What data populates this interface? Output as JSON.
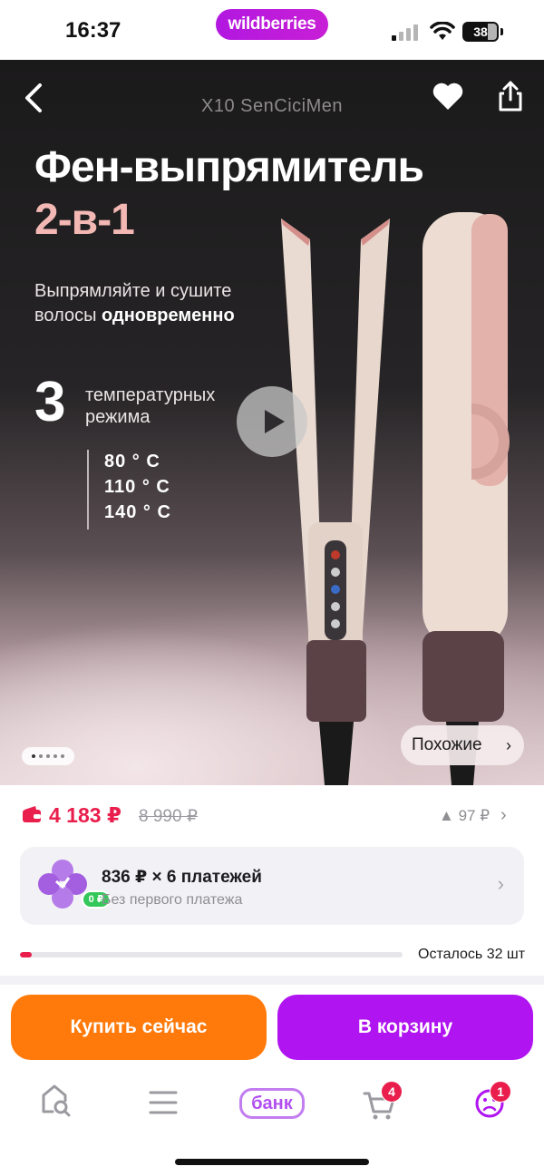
{
  "status_bar": {
    "time": "16:37",
    "brand_pill": "wildberries",
    "battery": "38",
    "icons": [
      "signal-icon",
      "wifi-icon",
      "battery-icon"
    ]
  },
  "hero": {
    "brand": "X10 SenCiciMen",
    "title_line1": "Фен-выпрямитель",
    "title_line2": "2-в-1",
    "subtitle_plain": "Выпрямляйте и сушите",
    "subtitle_line2_plain": "волосы ",
    "subtitle_bold": "одновременно",
    "modes_count": "3",
    "modes_line1": "температурных",
    "modes_line2": "режима",
    "temps": [
      "80 ° C",
      "110 ° C",
      "140 ° C"
    ],
    "similar_label": "Похожие",
    "slide_index": 1,
    "slide_count": 5,
    "colors": {
      "title_accent": "#f3b8b3"
    }
  },
  "price": {
    "current": "4 183 ₽",
    "old": "8 990 ₽",
    "delta": "97 ₽",
    "colors": {
      "current": "#e91e4c"
    }
  },
  "installment": {
    "title": "836 ₽ × 6 платежей",
    "subtitle": "Без первого платежа",
    "badge": "0 ₽"
  },
  "stock": {
    "label": "Осталось 32 шт",
    "level": 0.03
  },
  "actions": {
    "buy_now": "Купить сейчас",
    "add_to_cart": "В корзину",
    "colors": {
      "buy_now": "#ff7a0a",
      "add_to_cart": "#b014f0"
    }
  },
  "tabbar": {
    "bank_label": "банк",
    "cart_badge": "4",
    "profile_badge": "1",
    "icons": [
      "home-search-icon",
      "catalog-menu-icon",
      "bank-icon",
      "cart-icon",
      "profile-icon"
    ]
  }
}
